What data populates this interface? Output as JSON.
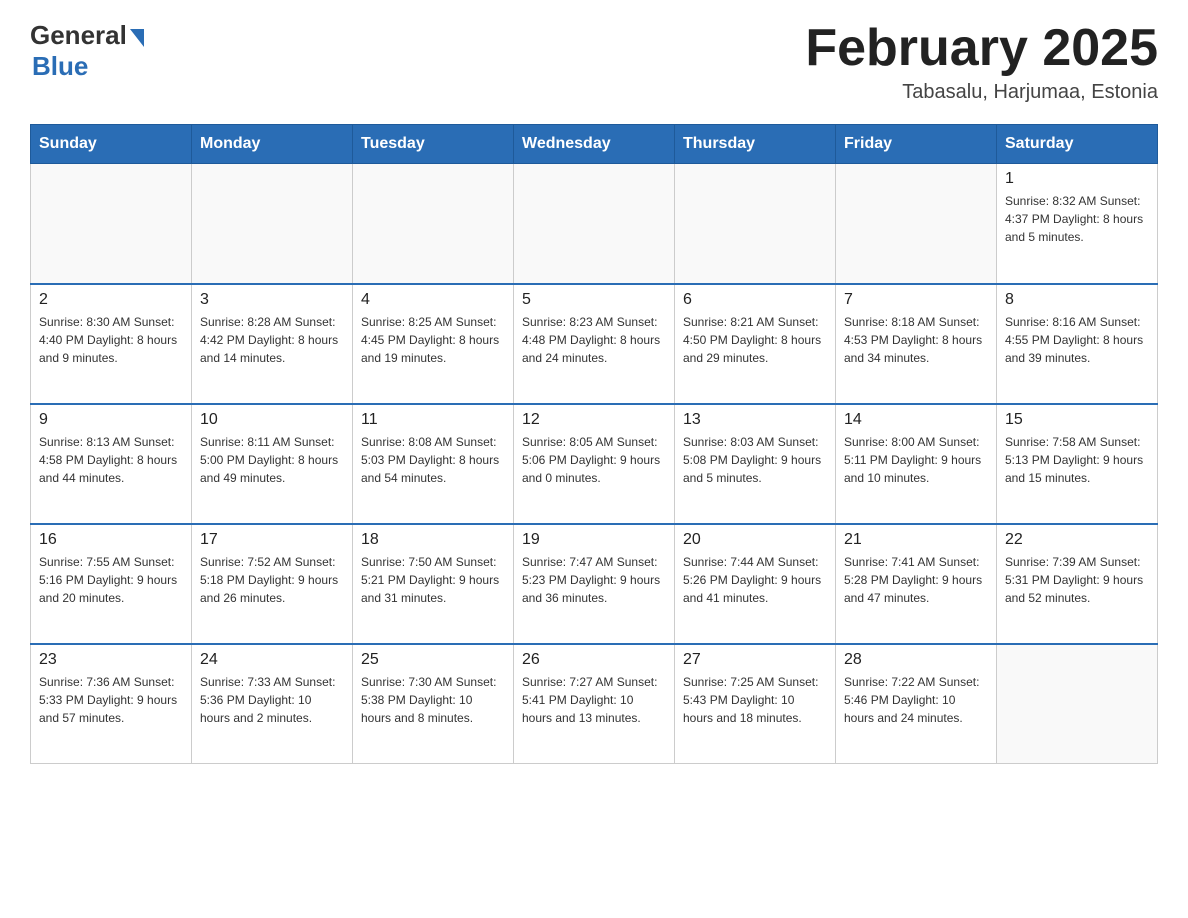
{
  "logo": {
    "general": "General",
    "blue": "Blue"
  },
  "title": "February 2025",
  "subtitle": "Tabasalu, Harjumaa, Estonia",
  "weekdays": [
    "Sunday",
    "Monday",
    "Tuesday",
    "Wednesday",
    "Thursday",
    "Friday",
    "Saturday"
  ],
  "weeks": [
    [
      {
        "day": "",
        "info": ""
      },
      {
        "day": "",
        "info": ""
      },
      {
        "day": "",
        "info": ""
      },
      {
        "day": "",
        "info": ""
      },
      {
        "day": "",
        "info": ""
      },
      {
        "day": "",
        "info": ""
      },
      {
        "day": "1",
        "info": "Sunrise: 8:32 AM\nSunset: 4:37 PM\nDaylight: 8 hours and 5 minutes."
      }
    ],
    [
      {
        "day": "2",
        "info": "Sunrise: 8:30 AM\nSunset: 4:40 PM\nDaylight: 8 hours and 9 minutes."
      },
      {
        "day": "3",
        "info": "Sunrise: 8:28 AM\nSunset: 4:42 PM\nDaylight: 8 hours and 14 minutes."
      },
      {
        "day": "4",
        "info": "Sunrise: 8:25 AM\nSunset: 4:45 PM\nDaylight: 8 hours and 19 minutes."
      },
      {
        "day": "5",
        "info": "Sunrise: 8:23 AM\nSunset: 4:48 PM\nDaylight: 8 hours and 24 minutes."
      },
      {
        "day": "6",
        "info": "Sunrise: 8:21 AM\nSunset: 4:50 PM\nDaylight: 8 hours and 29 minutes."
      },
      {
        "day": "7",
        "info": "Sunrise: 8:18 AM\nSunset: 4:53 PM\nDaylight: 8 hours and 34 minutes."
      },
      {
        "day": "8",
        "info": "Sunrise: 8:16 AM\nSunset: 4:55 PM\nDaylight: 8 hours and 39 minutes."
      }
    ],
    [
      {
        "day": "9",
        "info": "Sunrise: 8:13 AM\nSunset: 4:58 PM\nDaylight: 8 hours and 44 minutes."
      },
      {
        "day": "10",
        "info": "Sunrise: 8:11 AM\nSunset: 5:00 PM\nDaylight: 8 hours and 49 minutes."
      },
      {
        "day": "11",
        "info": "Sunrise: 8:08 AM\nSunset: 5:03 PM\nDaylight: 8 hours and 54 minutes."
      },
      {
        "day": "12",
        "info": "Sunrise: 8:05 AM\nSunset: 5:06 PM\nDaylight: 9 hours and 0 minutes."
      },
      {
        "day": "13",
        "info": "Sunrise: 8:03 AM\nSunset: 5:08 PM\nDaylight: 9 hours and 5 minutes."
      },
      {
        "day": "14",
        "info": "Sunrise: 8:00 AM\nSunset: 5:11 PM\nDaylight: 9 hours and 10 minutes."
      },
      {
        "day": "15",
        "info": "Sunrise: 7:58 AM\nSunset: 5:13 PM\nDaylight: 9 hours and 15 minutes."
      }
    ],
    [
      {
        "day": "16",
        "info": "Sunrise: 7:55 AM\nSunset: 5:16 PM\nDaylight: 9 hours and 20 minutes."
      },
      {
        "day": "17",
        "info": "Sunrise: 7:52 AM\nSunset: 5:18 PM\nDaylight: 9 hours and 26 minutes."
      },
      {
        "day": "18",
        "info": "Sunrise: 7:50 AM\nSunset: 5:21 PM\nDaylight: 9 hours and 31 minutes."
      },
      {
        "day": "19",
        "info": "Sunrise: 7:47 AM\nSunset: 5:23 PM\nDaylight: 9 hours and 36 minutes."
      },
      {
        "day": "20",
        "info": "Sunrise: 7:44 AM\nSunset: 5:26 PM\nDaylight: 9 hours and 41 minutes."
      },
      {
        "day": "21",
        "info": "Sunrise: 7:41 AM\nSunset: 5:28 PM\nDaylight: 9 hours and 47 minutes."
      },
      {
        "day": "22",
        "info": "Sunrise: 7:39 AM\nSunset: 5:31 PM\nDaylight: 9 hours and 52 minutes."
      }
    ],
    [
      {
        "day": "23",
        "info": "Sunrise: 7:36 AM\nSunset: 5:33 PM\nDaylight: 9 hours and 57 minutes."
      },
      {
        "day": "24",
        "info": "Sunrise: 7:33 AM\nSunset: 5:36 PM\nDaylight: 10 hours and 2 minutes."
      },
      {
        "day": "25",
        "info": "Sunrise: 7:30 AM\nSunset: 5:38 PM\nDaylight: 10 hours and 8 minutes."
      },
      {
        "day": "26",
        "info": "Sunrise: 7:27 AM\nSunset: 5:41 PM\nDaylight: 10 hours and 13 minutes."
      },
      {
        "day": "27",
        "info": "Sunrise: 7:25 AM\nSunset: 5:43 PM\nDaylight: 10 hours and 18 minutes."
      },
      {
        "day": "28",
        "info": "Sunrise: 7:22 AM\nSunset: 5:46 PM\nDaylight: 10 hours and 24 minutes."
      },
      {
        "day": "",
        "info": ""
      }
    ]
  ]
}
